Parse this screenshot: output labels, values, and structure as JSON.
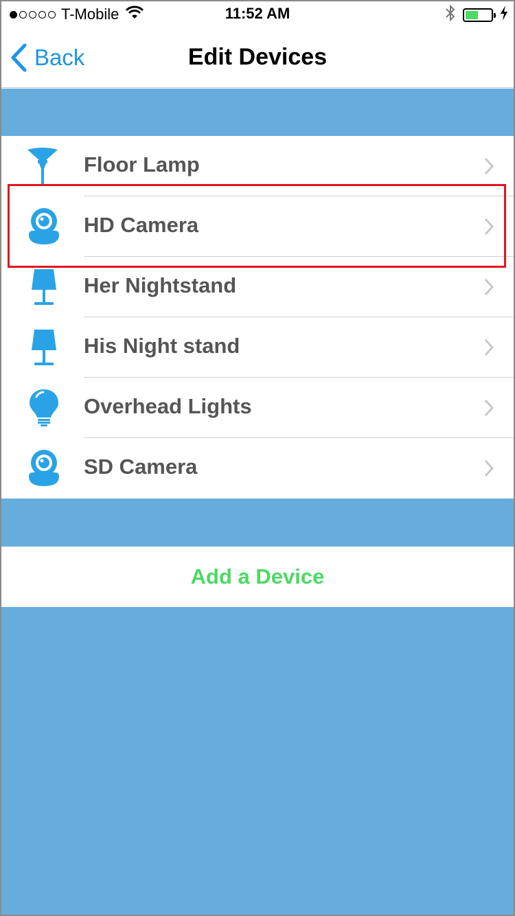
{
  "status_bar": {
    "carrier": "T-Mobile",
    "time": "11:52 AM",
    "signal_bars_filled": 1,
    "signal_bars_total": 5,
    "battery_level": 0.5
  },
  "nav": {
    "back_label": "Back",
    "title": "Edit Devices"
  },
  "devices": [
    {
      "label": "Floor Lamp",
      "icon": "floor-lamp-icon"
    },
    {
      "label": "HD Camera",
      "icon": "camera-icon"
    },
    {
      "label": "Her Nightstand",
      "icon": "table-lamp-icon"
    },
    {
      "label": "His Night stand",
      "icon": "table-lamp-icon"
    },
    {
      "label": "Overhead Lights",
      "icon": "light-bulb-icon"
    },
    {
      "label": "SD Camera",
      "icon": "camera-icon"
    }
  ],
  "add_device_label": "Add a Device",
  "colors": {
    "accent": "#1f94e8",
    "band": "#66addd",
    "icon": "#29a3e6",
    "add": "#4cd964",
    "highlight": "#e3141e"
  }
}
